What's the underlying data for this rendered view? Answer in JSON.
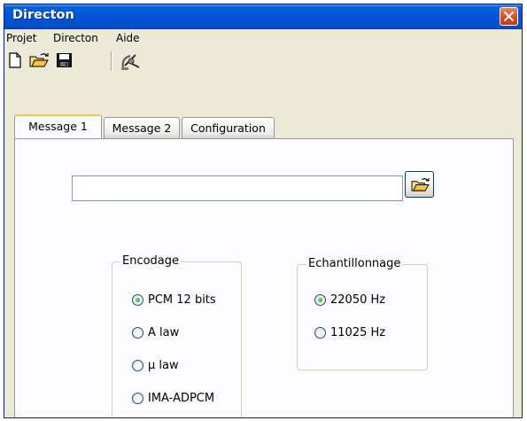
{
  "window": {
    "title": "Directon"
  },
  "menu": {
    "items": [
      "Projet",
      "Directon",
      "Aide"
    ]
  },
  "toolbar": {
    "icons": [
      "new-document-icon",
      "open-folder-icon",
      "save-icon",
      "satellite-icon"
    ]
  },
  "tabs": [
    {
      "label": "Message 1",
      "active": true
    },
    {
      "label": "Message 2",
      "active": false
    },
    {
      "label": "Configuration",
      "active": false
    }
  ],
  "file": {
    "path_value": "",
    "placeholder": ""
  },
  "encodage": {
    "title": "Encodage",
    "options": [
      {
        "label": "PCM 12 bits",
        "checked": true
      },
      {
        "label": "A law",
        "checked": false
      },
      {
        "label": "µ law",
        "checked": false
      },
      {
        "label": "IMA-ADPCM",
        "checked": false
      }
    ]
  },
  "echantillonnage": {
    "title": "Echantillonnage",
    "options": [
      {
        "label": "22050 Hz",
        "checked": true
      },
      {
        "label": "11025 Hz",
        "checked": false
      }
    ]
  },
  "colors": {
    "titlebar": "#0352d6",
    "close_button": "#d44d24",
    "window_face": "#ece9d8",
    "tab_highlight": "#ffc83c",
    "radio_check": "#21a121"
  }
}
